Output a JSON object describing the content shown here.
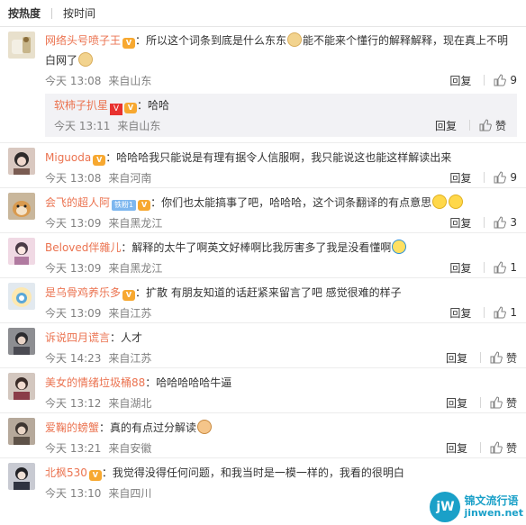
{
  "sort_tabs": {
    "hot": "按热度",
    "time": "按时间"
  },
  "reply_label": "回复",
  "like_label": "赞",
  "comments": [
    {
      "user": "网络头号喷子王",
      "text_a": "：所以这个词条到底是什么东东",
      "text_b": "能不能来个懂行的解释解释，现在真上不明白网了",
      "time": "今天 13:08",
      "place": "来自山东",
      "likes": "9",
      "sub": {
        "user": "软柿子扒星",
        "text": "：哈哈",
        "time": "今天 13:11",
        "place": "来自山东"
      }
    },
    {
      "user": "Miguoda",
      "text": "：哈哈哈我只能说是有理有据令人信服啊，我只能说这也能这样解读出来",
      "time": "今天 13:08",
      "place": "来自河南",
      "likes": "9"
    },
    {
      "user": "会飞的超人阿",
      "badge": "铁粉1",
      "text": "：你们也太能搞事了吧，哈哈哈，这个词条翻译的有点意思",
      "time": "今天 13:09",
      "place": "来自黑龙江",
      "likes": "3"
    },
    {
      "user": "Beloved伴雜儿",
      "text": "：解释的太牛了啊英文好棒啊比我厉害多了我是没看懂啊",
      "time": "今天 13:09",
      "place": "来自黑龙江",
      "likes": "1"
    },
    {
      "user": "是乌骨鸡养乐多",
      "text": "：扩散 有朋友知道的话赶紧来留言了吧 感觉很难的样子",
      "time": "今天 13:09",
      "place": "来自江苏",
      "likes": "1"
    },
    {
      "user": "诉说四月谎言",
      "text": "：人才",
      "time": "今天 14:23",
      "place": "来自江苏",
      "likes": "赞"
    },
    {
      "user": "美女的情绪垃圾桶88",
      "text": "：哈哈哈哈哈牛逼",
      "time": "今天 13:12",
      "place": "来自湖北",
      "likes": "赞"
    },
    {
      "user": "爱鞠的螃蟹",
      "text": "：真的有点过分解读",
      "time": "今天 13:21",
      "place": "来自安徽",
      "likes": "赞"
    },
    {
      "user": "北枫530",
      "text": "：我觉得没得任何问题，和我当时是一模一样的，我看的很明白",
      "time": "今天 13:10",
      "place": "来自四川",
      "likes": ""
    }
  ],
  "watermark": {
    "logo": "jW",
    "name": "锦文流行语",
    "url": "jinwen.net"
  },
  "colors": {
    "username": "#eb7350",
    "meta": "#808080",
    "vip": "#f7a830",
    "watermark": "#1aa0c8"
  }
}
